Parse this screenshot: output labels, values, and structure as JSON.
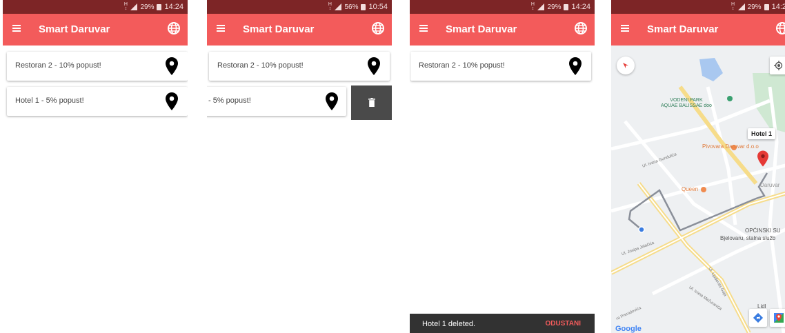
{
  "app": {
    "title": "Smart Daruvar"
  },
  "screens": [
    {
      "status": {
        "battery": "29%",
        "time": "14:24"
      },
      "items": [
        {
          "label": "Restoran 2 - 10% popust!"
        },
        {
          "label": "Hotel 1 - 5% popust!"
        }
      ]
    },
    {
      "status": {
        "battery": "56%",
        "time": "10:54"
      },
      "items": [
        {
          "label": "Restoran 2 - 10% popust!"
        },
        {
          "label": "- 5% popust!"
        }
      ]
    },
    {
      "status": {
        "battery": "29%",
        "time": "14:24"
      },
      "items": [
        {
          "label": "Restoran 2 - 10% popust!"
        }
      ],
      "snackbar": {
        "message": "Hotel 1 deleted.",
        "action": "ODUSTANI"
      }
    },
    {
      "status": {
        "battery": "29%",
        "time": "14:2"
      },
      "map": {
        "marker_label": "Hotel 1",
        "labels": {
          "park_line1": "VODENI PARK",
          "park_line2": "AQUAE BALISSAE doo",
          "pivovara": "Pivovara Daruvar d.o.o",
          "queen": "Queen",
          "daruvar": "Daruvar",
          "opcinski": "OPĆINSKI SU",
          "bjelovaru": "Bjelovaru, stalna služb",
          "jelacica": "Ul. Josipa Jelačića",
          "gaja": "Ul. Ljudevita Gaja",
          "mazuranica": "Ul. Ivana Mažuranića",
          "gundulica": "Ul. Ivana Gundulića",
          "preradovica": "ra Preradovića",
          "lidl": "Lidl",
          "google": "Google"
        }
      }
    }
  ],
  "colors": {
    "status_bar": "#7d2526",
    "app_bar": "#f35b5b",
    "snackbar": "#323232",
    "snackbar_action": "#f35b5b",
    "delete_background": "#4a4a4a",
    "route": "#8a8f99",
    "marker": "#e53935"
  },
  "icons": {
    "menu": "menu-icon",
    "globe": "globe-icon",
    "pin": "location-pin-icon",
    "trash": "trash-icon",
    "compass": "compass-icon",
    "my_location": "my-location-icon",
    "directions": "directions-icon",
    "maps": "google-maps-icon"
  }
}
